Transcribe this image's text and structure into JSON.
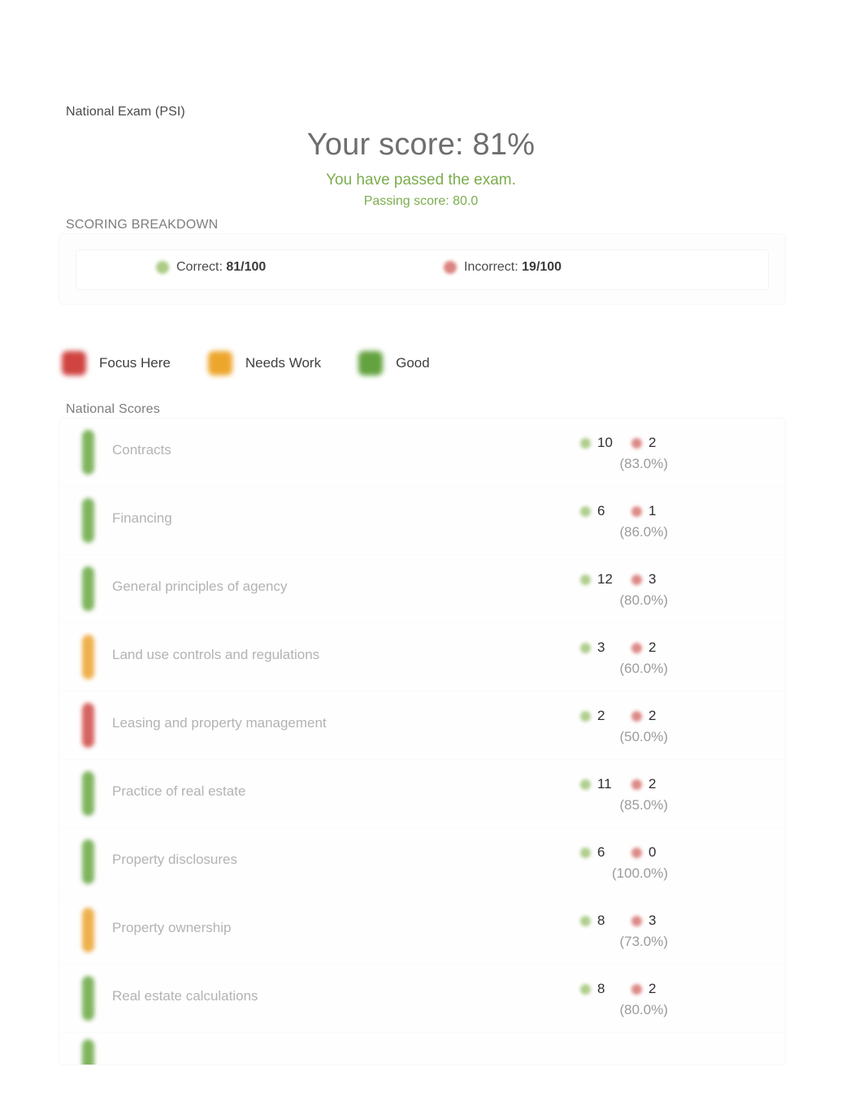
{
  "exam": {
    "name": "National Exam (PSI)",
    "score_title": "Your score: 81%",
    "pass_message": "You have passed the exam.",
    "passing_score": "Passing score: 80.0"
  },
  "scoring_breakdown": {
    "heading": "SCORING BREAKDOWN",
    "correct_label": "Correct:",
    "correct_value": "81/100",
    "incorrect_label": "Incorrect:",
    "incorrect_value": "19/100",
    "correct_icon": "green-circle-icon",
    "incorrect_icon": "red-circle-icon"
  },
  "legend": {
    "items": [
      {
        "label": "Focus Here",
        "color": "#cf4440",
        "icon": "red-square-icon"
      },
      {
        "label": "Needs Work",
        "color": "#eda62c",
        "icon": "amber-square-icon"
      },
      {
        "label": "Good",
        "color": "#63a23f",
        "icon": "green-square-icon"
      }
    ]
  },
  "national_scores": {
    "heading": "National Scores",
    "rows": [
      {
        "label": "Contracts",
        "correct": "10",
        "incorrect": "2",
        "percent": "(83.0%)",
        "status": "good",
        "bar_color": "#6aa844"
      },
      {
        "label": "Financing",
        "correct": "6",
        "incorrect": "1",
        "percent": "(86.0%)",
        "status": "good",
        "bar_color": "#6aa844"
      },
      {
        "label": "General principles of agency",
        "correct": "12",
        "incorrect": "3",
        "percent": "(80.0%)",
        "status": "good",
        "bar_color": "#6aa844"
      },
      {
        "label": "Land use controls and regulations",
        "correct": "3",
        "incorrect": "2",
        "percent": "(60.0%)",
        "status": "needs-work",
        "bar_color": "#eca430"
      },
      {
        "label": "Leasing and property management",
        "correct": "2",
        "incorrect": "2",
        "percent": "(50.0%)",
        "status": "focus-here",
        "bar_color": "#cf4a46"
      },
      {
        "label": "Practice of real estate",
        "correct": "11",
        "incorrect": "2",
        "percent": "(85.0%)",
        "status": "good",
        "bar_color": "#6aa844"
      },
      {
        "label": "Property disclosures",
        "correct": "6",
        "incorrect": "0",
        "percent": "(100.0%)",
        "status": "good",
        "bar_color": "#6aa844"
      },
      {
        "label": "Property ownership",
        "correct": "8",
        "incorrect": "3",
        "percent": "(73.0%)",
        "status": "needs-work",
        "bar_color": "#eca430"
      },
      {
        "label": "Real estate calculations",
        "correct": "8",
        "incorrect": "2",
        "percent": "(80.0%)",
        "status": "good",
        "bar_color": "#6aa844"
      }
    ],
    "partial_row": {
      "label": "",
      "status": "good",
      "bar_color": "#6aa844"
    }
  }
}
